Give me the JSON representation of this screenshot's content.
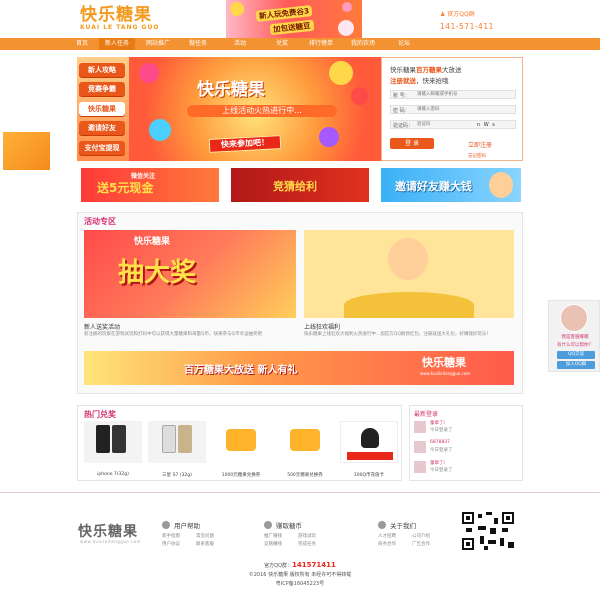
{
  "header": {
    "logo_main": "快乐糖果",
    "logo_sub": "KUAI LE TANG GUO",
    "banner_line1": "新人玩免费谷3",
    "banner_line2": "加包送糖豆",
    "qq_label": "官方QQ群",
    "qq_number": "141-571-411"
  },
  "nav": {
    "items": [
      {
        "label": "首页"
      },
      {
        "label": "新人任务"
      },
      {
        "label": "网站推广"
      },
      {
        "label": "做任务"
      },
      {
        "label": "活动"
      },
      {
        "label": "兑奖"
      },
      {
        "label": "排行榜单"
      },
      {
        "label": "我的农场"
      },
      {
        "label": "论坛"
      }
    ]
  },
  "hero": {
    "side_items": [
      {
        "label": "新人攻略"
      },
      {
        "label": "竞赛争霸"
      },
      {
        "label": "快乐糖果"
      },
      {
        "label": "邀请好友"
      },
      {
        "label": "支付宝提现"
      }
    ],
    "title": "快乐糖果",
    "ribbon": "上线活动火热进行中...",
    "cta": "快来参加吧！",
    "login": {
      "line1_prefix": "快乐糖果",
      "line1_highlight": "百万糖果",
      "line1_suffix": "大放送",
      "line2_highlight": "注册就送",
      "line2_suffix": "，快来抢哦",
      "account_label": "账 号：",
      "account_placeholder": "请输入邮箱或手机号",
      "password_label": "密 码：",
      "password_placeholder": "请输入密码",
      "captcha_label": "验证码：",
      "captcha_placeholder": "验证码",
      "captcha_text": "n W s",
      "login_button": "登 录",
      "register_link": "立即注册",
      "forgot_link": "忘记密码"
    }
  },
  "promos": [
    {
      "main": "送5元现金",
      "sub": "微信关注"
    },
    {
      "main": "竞猜给利",
      "sub": ""
    },
    {
      "main": "邀请好友赚大钱",
      "sub": ""
    }
  ],
  "activity": {
    "title": "活动专区",
    "card1_title": "快乐糖果",
    "card1_big": "抽大奖",
    "card1_caption": "新人送奖活动",
    "card1_desc": "新注册的玩家在游戏试玩和打码中可以获得大量糖果和海量Q币，快来参与Q币幸运抽奖吧",
    "card2_caption": "上线狂欢福利",
    "card2_desc": "快乐糖果上线狂欢大福利火热进行中...加官方QQ群领红包，注册就送大礼包，好赚钱好玩乐！",
    "strip_text": "百万糖果大放送 新人有礼",
    "strip_brand": "快乐糖果",
    "strip_url": "www.kuaileitangguo.com"
  },
  "exchange": {
    "title": "热门兑奖",
    "products": [
      {
        "label": "iphone 7(32g)"
      },
      {
        "label": "三星 S7 (32g)"
      },
      {
        "label": "1000元糖果兑换券"
      },
      {
        "label": "500元糖果兑换券"
      },
      {
        "label": "100Q币充值卡"
      }
    ]
  },
  "latest": {
    "title": "最新登录",
    "rows": [
      {
        "name": "童章了i",
        "stat": "今日登录了"
      },
      {
        "name": "6878837",
        "stat": "今日登录了"
      },
      {
        "name": "童章了i",
        "stat": "今日登录了"
      }
    ]
  },
  "footer": {
    "logo": "快乐糖果",
    "logo_sub": "www.kuaileitangguo.com",
    "col1_title": "用户帮助",
    "col1_links": [
      "新手指南",
      "常见问题",
      "用户协议",
      "联系客服"
    ],
    "col2_title": "赚取糖币",
    "col2_links": [
      "推广赚钱",
      "游戏试玩",
      "竞猜赚钱",
      "完成任务"
    ],
    "col3_title": "关于我们",
    "col3_links": [
      "人才招聘",
      "公司介绍",
      "商务合作",
      "广告合作"
    ],
    "qq_prefix": "官方QQ群：",
    "qq_number": "141571411",
    "copyright": "©2016 快乐糖果 版权所有 未经许可不得转载",
    "icp": "粤ICP备16045223号"
  },
  "float_right": {
    "line1": "我是客服嘟嘟",
    "line2": "有什么可以帮你？",
    "qq1": "QQ交谈",
    "qq2": "加入QQ群"
  }
}
